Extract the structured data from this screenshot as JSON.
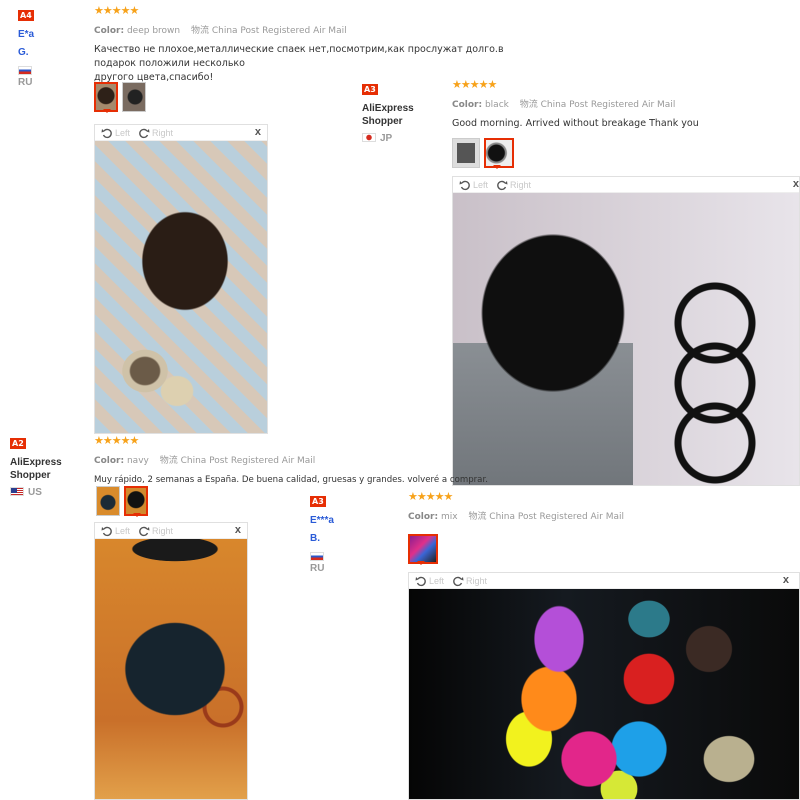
{
  "reviews": [
    {
      "badge": "A4",
      "user": "E*a G.",
      "country": "RU",
      "color_label": "Color:",
      "color_value": "deep brown",
      "shipping": "物流 China Post Registered Air Mail",
      "stars": "★★★★★",
      "text_line1": "Качество не плохое,металлические спаек нет,посмотрим,как прослужат долго.в подарок положили несколько",
      "text_line2": "другого цвета,спасибо!"
    },
    {
      "badge": "A3",
      "user_line1": "AliExpress",
      "user_line2": "Shopper",
      "country": "JP",
      "color_label": "Color:",
      "color_value": "black",
      "shipping": "物流 China Post Registered Air Mail",
      "stars": "★★★★★",
      "text": "Good morning. Arrived without breakage Thank you"
    },
    {
      "badge": "A2",
      "user_line1": "AliExpress",
      "user_line2": "Shopper",
      "country": "US",
      "color_label": "Color:",
      "color_value": "navy",
      "shipping": "物流 China Post Registered Air Mail",
      "stars": "★★★★★",
      "text": "Muy rápido, 2 semanas a España. De buena calidad, gruesas y grandes. volveré a comprar."
    },
    {
      "badge": "A3",
      "user": "E***a B.",
      "country": "RU",
      "color_label": "Color:",
      "color_value": "mix",
      "shipping": "物流 China Post Registered Air Mail",
      "stars": "★★★★★"
    }
  ],
  "viewer": {
    "left_label": "Left",
    "right_label": "Right",
    "close_label": "x"
  },
  "icons": {
    "rotate_left": "rotate-left-icon",
    "rotate_right": "rotate-right-icon",
    "close": "close-icon",
    "star": "star-icon"
  },
  "colors": {
    "accent": "#e62e04",
    "star": "#f7a21a",
    "username": "#2a5bd7"
  }
}
